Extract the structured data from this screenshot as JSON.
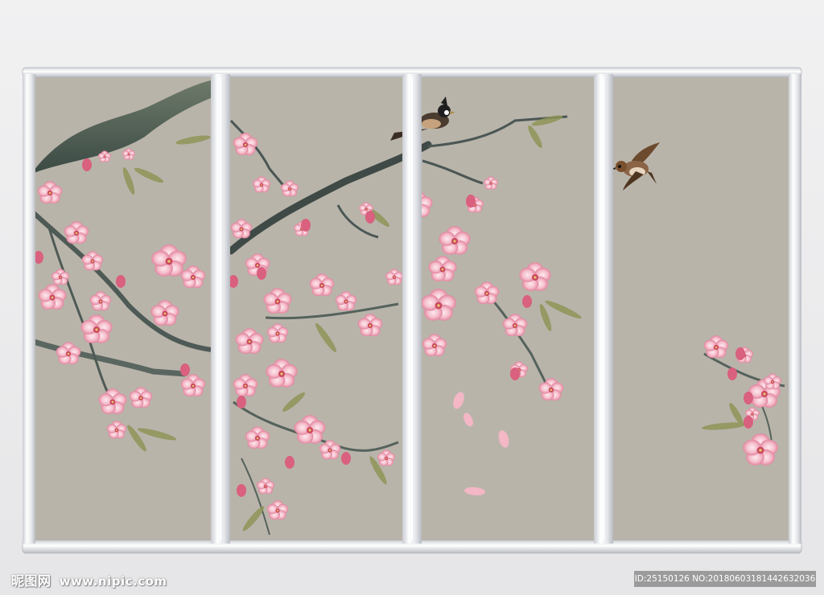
{
  "watermark": {
    "brand": "昵图网",
    "url": "www.nipic.com",
    "id_label": "ID:25150126 NO:20180603181442632036"
  },
  "artwork": {
    "panel_count": 4,
    "colors": {
      "background": "#b9b4aa",
      "frame": "#e4e6ea",
      "blossom": "#f3bccb",
      "blossom_dark": "#d9607f",
      "branch": "#3f4a47",
      "leaf": "#8f9457"
    }
  }
}
